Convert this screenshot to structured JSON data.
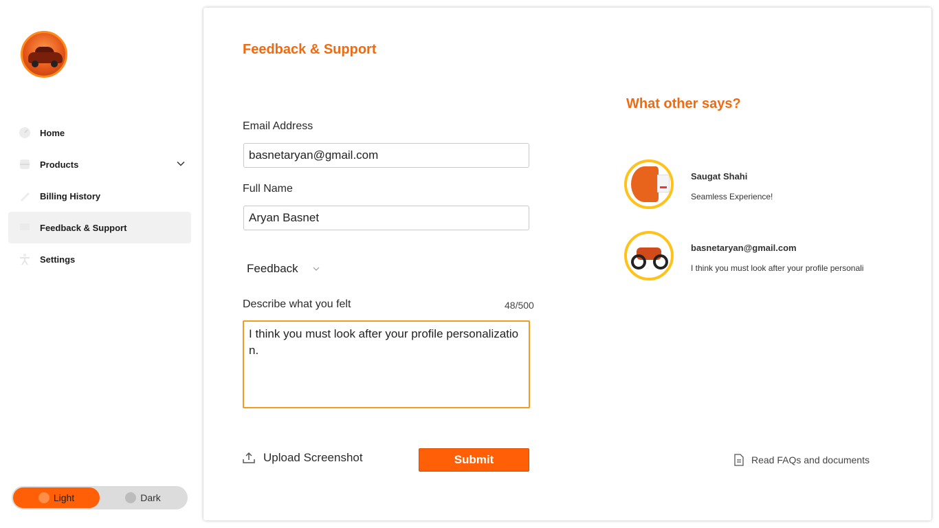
{
  "sidebar": {
    "logo_alt": "car logo",
    "items": [
      {
        "label": "Home",
        "icon": "dashboard-icon"
      },
      {
        "label": "Products",
        "icon": "box-icon"
      },
      {
        "label": "Billing History",
        "icon": "pen-icon"
      },
      {
        "label": "Feedback & Support",
        "icon": "chat-icon"
      },
      {
        "label": "Settings",
        "icon": "accessibility-icon"
      }
    ],
    "active_item": "Feedback & Support",
    "theme": {
      "light_label": "Light",
      "dark_label": "Dark",
      "selected": "Light"
    }
  },
  "main": {
    "title": "Feedback & Support",
    "form": {
      "email_label": "Email Address",
      "email_value": "basnetaryan@gmail.com",
      "name_label": "Full Name",
      "name_value": "Aryan Basnet",
      "type_value": "Feedback",
      "describe_label": "Describe what you felt",
      "counter": "48/500",
      "message": "I think you must look after your profile personalization.",
      "upload_label": "Upload Screenshot",
      "submit_label": "Submit"
    },
    "reviews": {
      "title": "What other says?",
      "items": [
        {
          "name": "Saugat Shahi",
          "text": "Seamless Experience!"
        },
        {
          "name": "basnetaryan@gmail.com",
          "text": "I think you must look after your profile personalization."
        }
      ]
    },
    "faq_label": "Read FAQs and documents"
  },
  "colors": {
    "accent": "#ff5f06",
    "title": "#f06a12",
    "textarea_border": "#f29b1f",
    "avatar_ring": "#ffc21a"
  }
}
